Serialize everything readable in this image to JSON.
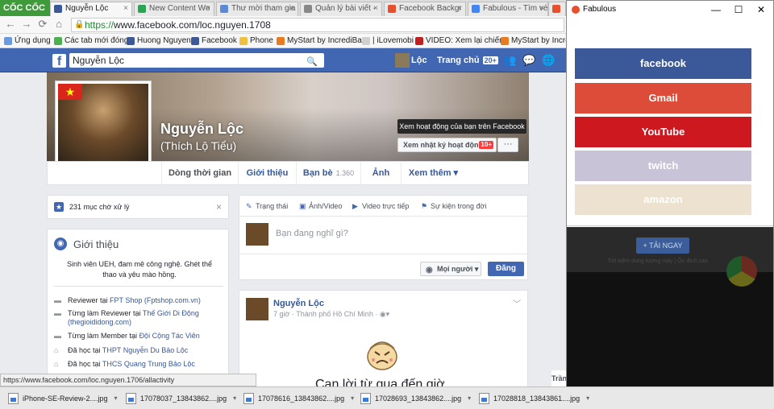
{
  "browser": {
    "logo": "CỐC CỐC",
    "tabs": [
      {
        "label": "Nguyễn Lộc",
        "color": "#3b5998",
        "active": true
      },
      {
        "label": "New Content Wo",
        "color": "#2aa652"
      },
      {
        "label": "Thư mời tham gia",
        "color": "#5b8bd6"
      },
      {
        "label": "Quản lý bài viết -",
        "color": "#888888"
      },
      {
        "label": "Facebook Backgr",
        "color": "#e8502d"
      },
      {
        "label": "Fabulous - Tìm vé",
        "color": "#4285f4"
      },
      {
        "label": "",
        "color": "#e8502d"
      }
    ],
    "tab_close": "×",
    "url_https": "https://",
    "url_rest": "www.facebook.com/loc.nguyen.1708",
    "bookmarks": [
      {
        "label": "Ứng dụng",
        "color": "#6a9ae0"
      },
      {
        "label": "Các tab mới đóng",
        "color": "#4caf50"
      },
      {
        "label": "Huong Nguyen",
        "color": "#3b5998"
      },
      {
        "label": "Facebook",
        "color": "#3b5998"
      },
      {
        "label": "Phone",
        "color": "#f0c040"
      },
      {
        "label": "MyStart by IncrediBar",
        "color": "#e87a20"
      },
      {
        "label": "| iLovemobi",
        "color": "#d0d0d0"
      },
      {
        "label": "VIDEO: Xem lại chiến",
        "color": "#c02020"
      },
      {
        "label": "MyStart by Incred",
        "color": "#e87a20"
      }
    ],
    "status_url": "https://www.facebook.com/loc.nguyen.1706/allactivity"
  },
  "fb": {
    "search_value": "Nguyễn Lộc",
    "profile_short": "Lộc",
    "home_label": "Trang chủ",
    "home_count": "20+",
    "name": "Nguyễn Lộc",
    "alt_name": "(Thích Lộ Tiểu)",
    "tooltip": "Xem hoạt động của bạn trên Facebook",
    "activity_btn": "Xem nhật ký hoạt động",
    "activity_badge": "10+",
    "more": "···",
    "nav": {
      "timeline": "Dòng thời gian",
      "about": "Giới thiệu",
      "friends": "Bạn bè",
      "friends_count": "1.360",
      "photos": "Ảnh",
      "more": "Xem thêm ▾"
    },
    "pending": "231 mục chờ xử lý",
    "intro": {
      "title": "Giới thiệu",
      "bio": "Sinh viên UEH, đam mê công nghệ. Ghét thể thao và yêu mào hồng.",
      "items": [
        {
          "pre": "Reviewer tại ",
          "link": "FPT Shop (Fptshop.com.vn)",
          "icon": "briefcase-icon"
        },
        {
          "pre": "Từng làm Reviewer tại ",
          "link": "Thế Giới Di Động (thegioididong.com)",
          "icon": "briefcase-icon"
        },
        {
          "pre": "Từng làm Member tại ",
          "link": "Đội Cộng Tác Viên",
          "icon": "briefcase-icon"
        },
        {
          "pre": "Đã học tại ",
          "link": "THPT Nguyễn Du Bảo Lộc",
          "icon": "graduation-cap-icon"
        },
        {
          "pre": "Đã học tại ",
          "link": "THCS Quang Trung Bảo Lộc",
          "icon": "graduation-cap-icon"
        }
      ]
    },
    "composer": {
      "tabs": [
        "Trạng thái",
        "Ảnh/Video",
        "Video trực tiếp",
        "Sự kiện trong đời"
      ],
      "placeholder": "Bạn đang nghĩ gì?",
      "audience": "Mọi người ▾",
      "post": "Đăng"
    },
    "post": {
      "name": "Nguyễn Lộc",
      "time": "7 giờ",
      "place": "Thành phố Hồ Chí Minh",
      "text": "Cạn lời từ qua đến giờ"
    },
    "tran_label": "Trần"
  },
  "downloads": [
    "iPhone-SE-Review-2....jpg",
    "17078037_13843862....jpg",
    "17078616_13843862....jpg",
    "17028693_13843862....jpg",
    "17028818_13843861....jpg"
  ],
  "popup": {
    "title": "Fabulous",
    "minimize": "—",
    "maximize": "☐",
    "close": "✕",
    "services": [
      {
        "label": "facebook",
        "color": "#3b5998",
        "text_color": "#ffffff"
      },
      {
        "label": "Gmail",
        "color": "#dd4b39",
        "text_color": "#ffffff"
      },
      {
        "label": "YouTube",
        "color": "#cc181e",
        "text_color": "#ffffff"
      },
      {
        "label": "twitch",
        "color": "#c8c3d6",
        "text_color": "#ffffff"
      },
      {
        "label": "amazon",
        "color": "#ece2cf",
        "text_color": "#ffffff"
      }
    ],
    "bg_button": "+ TẢI NGAY",
    "bg_text": "Tiết kiệm dung lượng máy | Ổn định cao"
  }
}
